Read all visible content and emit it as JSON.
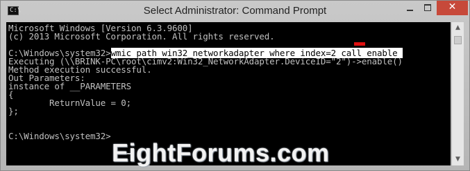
{
  "window": {
    "title": "Select Administrator: Command Prompt",
    "icon_label": "C:\\",
    "close_label": "✕"
  },
  "console": {
    "lines": [
      "Microsoft Windows [Version 6.3.9600]",
      "(c) 2013 Microsoft Corporation. All rights reserved.",
      "",
      "C:\\Windows\\system32>",
      "Executing (\\\\BRINK-PC\\root\\cimv2:Win32_NetworkAdapter.DeviceID=\"2\")->enable()",
      "Method execution successful.",
      "Out Parameters:",
      "instance of __PARAMETERS",
      "{",
      "        ReturnValue = 0;",
      "};",
      "",
      "",
      "C:\\Windows\\system32>"
    ],
    "selected_command": "wmic path win32_networkadapter where index=2 call enable "
  },
  "watermark": "EightForums.com",
  "colors": {
    "console_bg": "#000000",
    "console_fg": "#c0c0c0",
    "close_button": "#c7493a",
    "selection_marker": "#e01010"
  }
}
